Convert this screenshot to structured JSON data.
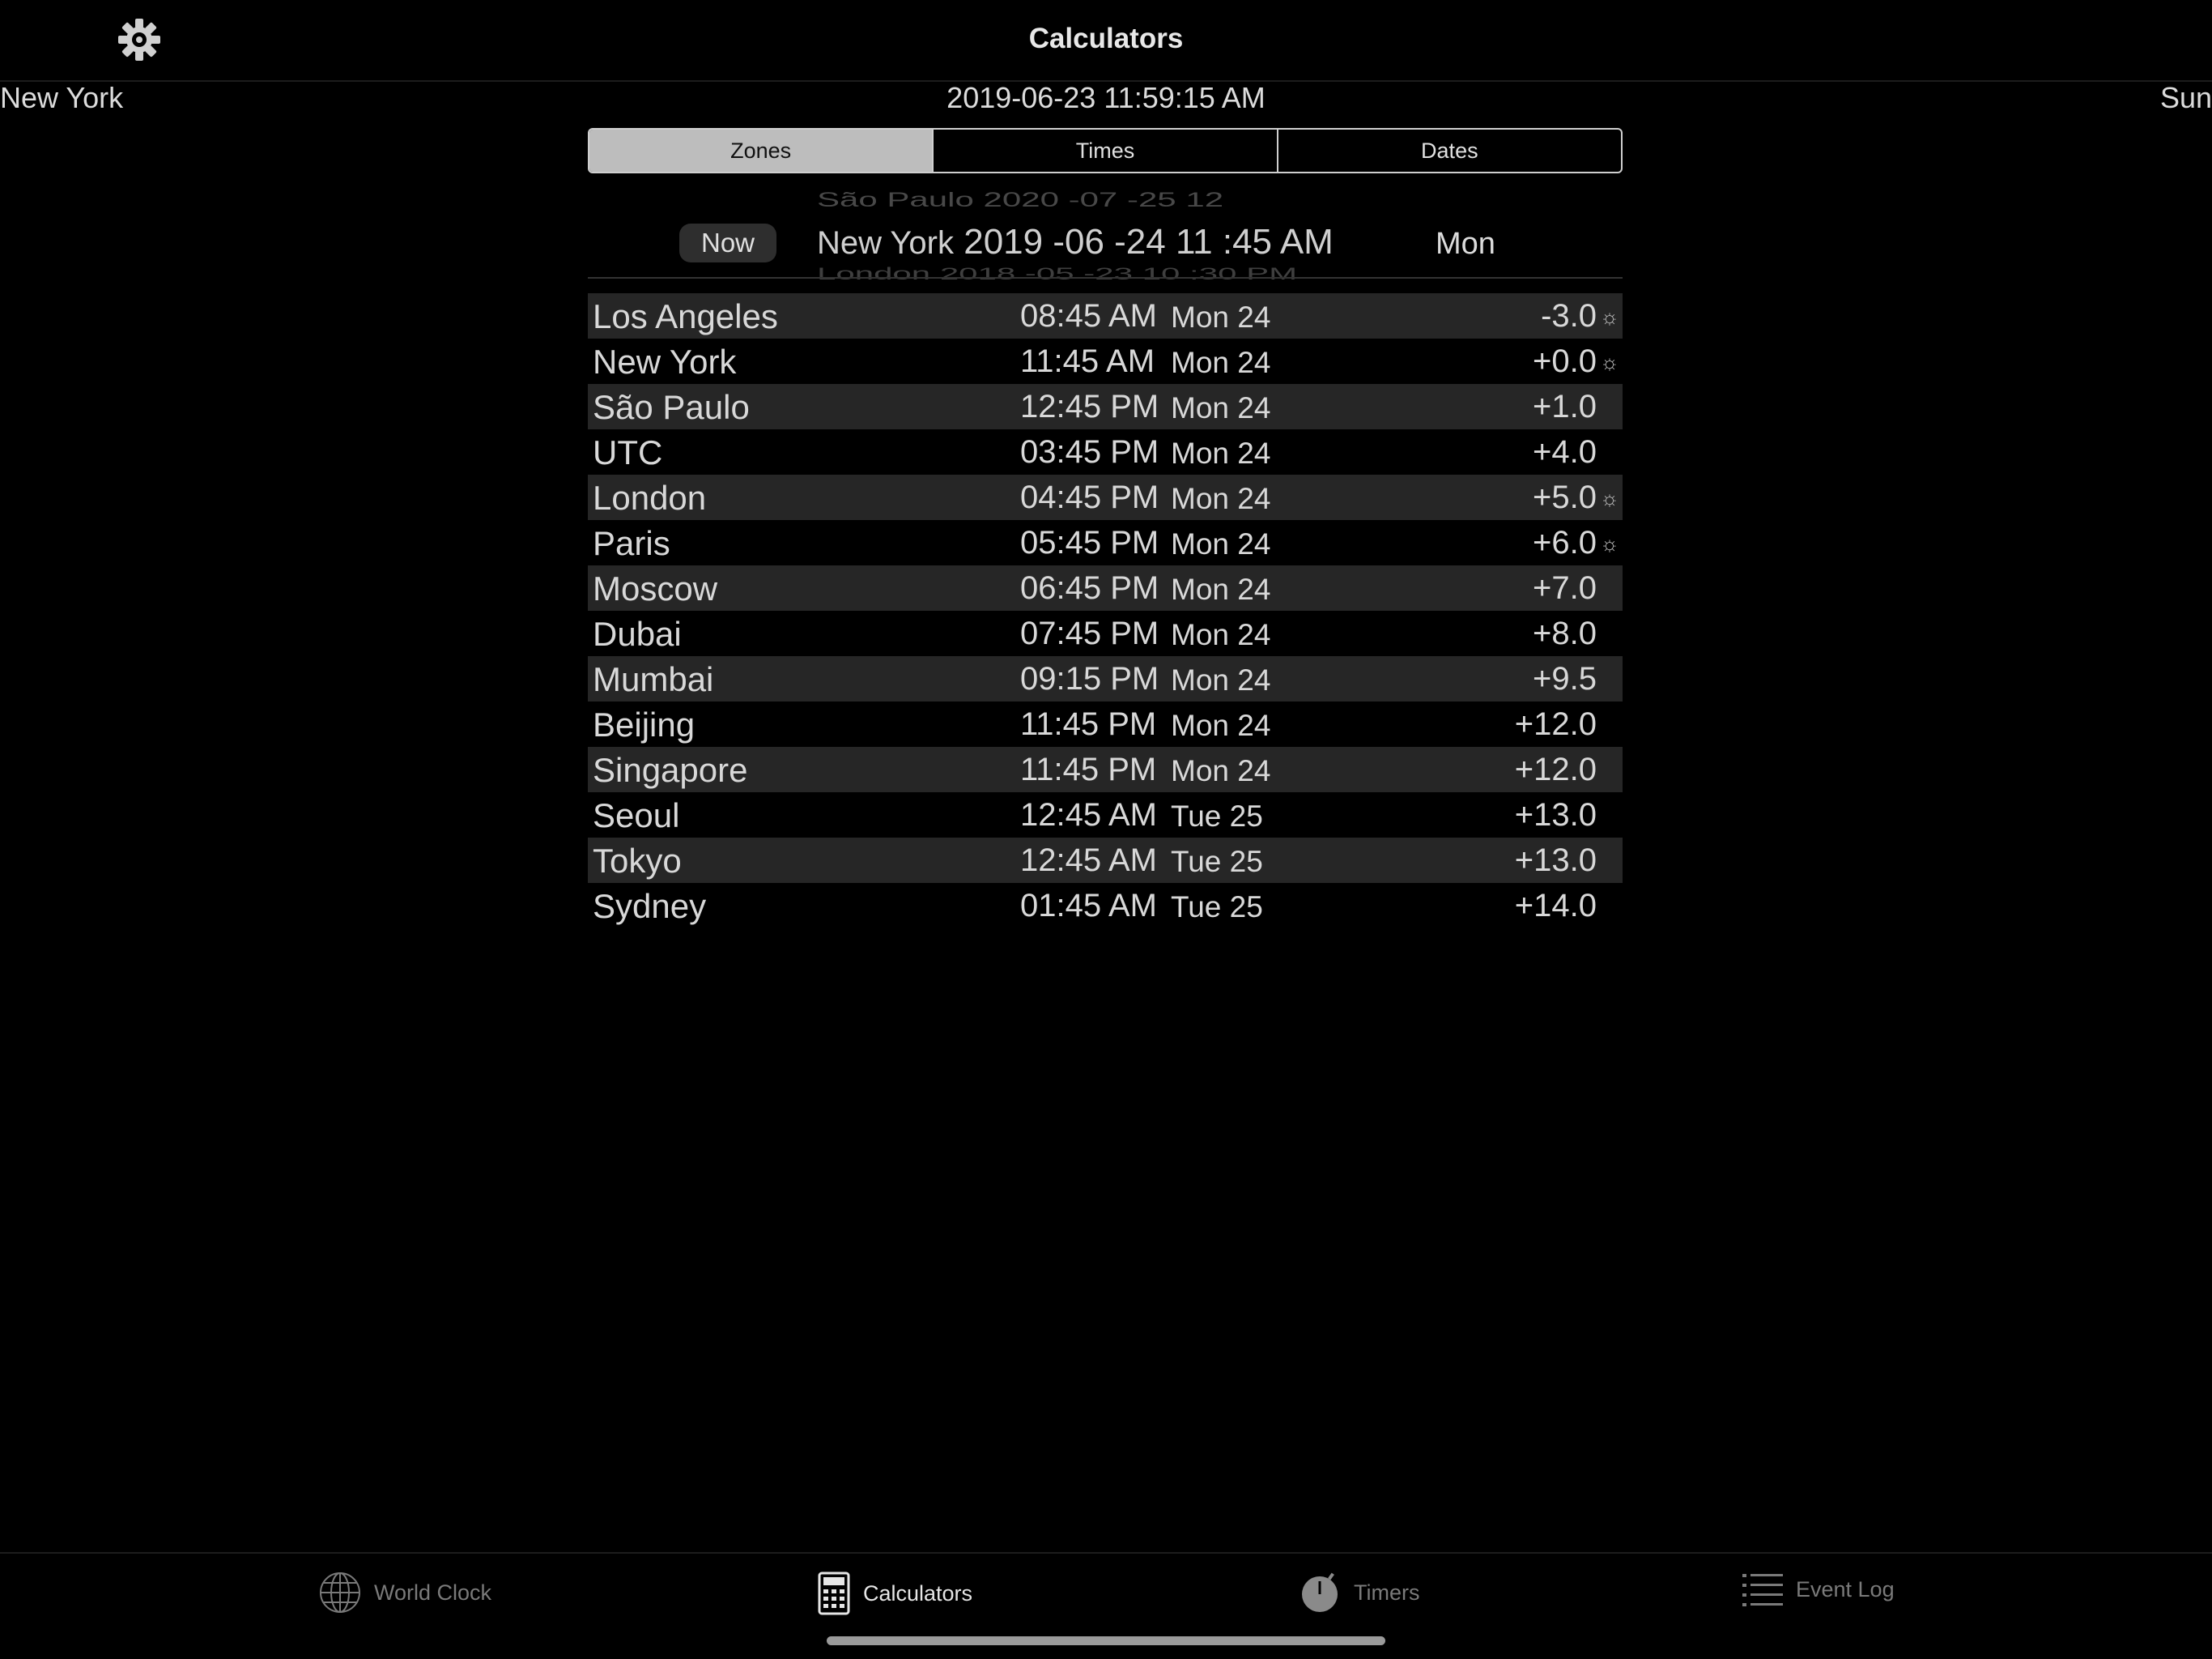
{
  "header": {
    "title": "Calculators",
    "city": "New York",
    "datetime": "2019-06-23 11:59:15 AM",
    "weekday": "Sun"
  },
  "segments": [
    "Zones",
    "Times",
    "Dates"
  ],
  "picker": {
    "now_label": "Now",
    "prev": "São Paulo 2020 -07 -25 12",
    "current_zone": "New York",
    "current_value": "2019 -06 -24  11 :45  AM",
    "next": "London 2018 -05 -23 10 :30 PM",
    "day": "Mon"
  },
  "zones": [
    {
      "city": "Los Angeles",
      "time": "08:45 AM",
      "day": "Mon 24",
      "offset": "-3.0",
      "dst": "☼"
    },
    {
      "city": "New York",
      "time": "11:45 AM",
      "day": "Mon 24",
      "offset": "+0.0",
      "dst": "☼"
    },
    {
      "city": "São Paulo",
      "time": "12:45 PM",
      "day": "Mon 24",
      "offset": "+1.0",
      "dst": ""
    },
    {
      "city": "UTC",
      "time": "03:45 PM",
      "day": "Mon 24",
      "offset": "+4.0",
      "dst": ""
    },
    {
      "city": "London",
      "time": "04:45 PM",
      "day": "Mon 24",
      "offset": "+5.0",
      "dst": "☼"
    },
    {
      "city": "Paris",
      "time": "05:45 PM",
      "day": "Mon 24",
      "offset": "+6.0",
      "dst": "☼"
    },
    {
      "city": "Moscow",
      "time": "06:45 PM",
      "day": "Mon 24",
      "offset": "+7.0",
      "dst": ""
    },
    {
      "city": "Dubai",
      "time": "07:45 PM",
      "day": "Mon 24",
      "offset": "+8.0",
      "dst": ""
    },
    {
      "city": "Mumbai",
      "time": "09:15 PM",
      "day": "Mon 24",
      "offset": "+9.5",
      "dst": ""
    },
    {
      "city": "Beijing",
      "time": "11:45 PM",
      "day": "Mon 24",
      "offset": "+12.0",
      "dst": ""
    },
    {
      "city": "Singapore",
      "time": "11:45 PM",
      "day": "Mon 24",
      "offset": "+12.0",
      "dst": ""
    },
    {
      "city": "Seoul",
      "time": "12:45 AM",
      "day": "Tue 25",
      "offset": "+13.0",
      "dst": ""
    },
    {
      "city": "Tokyo",
      "time": "12:45 AM",
      "day": "Tue 25",
      "offset": "+13.0",
      "dst": ""
    },
    {
      "city": "Sydney",
      "time": "01:45 AM",
      "day": "Tue 25",
      "offset": "+14.0",
      "dst": ""
    }
  ],
  "tabbar": {
    "world_clock": "World Clock",
    "calculators": "Calculators",
    "timers": "Timers",
    "event_log": "Event Log"
  }
}
